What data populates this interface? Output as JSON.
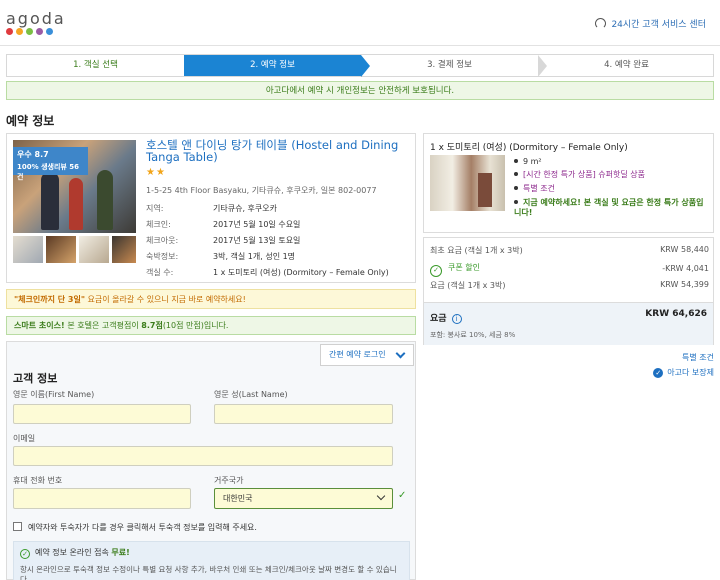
{
  "header": {
    "logo_text": "agoda",
    "logo_colors": [
      "#e03a3e",
      "#f5a623",
      "#7bbf43",
      "#9b5ba5",
      "#3a8fd9"
    ],
    "support_text": "24시간 고객 서비스 센터"
  },
  "steps": [
    {
      "label": "1. 객실 선택",
      "state": "done"
    },
    {
      "label": "2. 예약 정보",
      "state": "active"
    },
    {
      "label": "3. 결제 정보",
      "state": "pending"
    },
    {
      "label": "4. 예약 완료",
      "state": "pending"
    }
  ],
  "secure_notice": "아고다에서 예약 시 개인정보는 안전하게 보호됩니다.",
  "page_title": "예약 정보",
  "hotel": {
    "review_score": "우수 8.7",
    "review_count": "100% 생생리뷰 56건",
    "name": "호스텔 앤 다이닝 탕가 테이블 (Hostel and Dining Tanga Table)",
    "stars": "★★",
    "address": "1-5-25 4th Floor Basyaku, 기타큐슈, 후쿠오카, 일본 802-0077",
    "info": [
      {
        "key": "지역:",
        "value": "기타큐슈, 후쿠오카"
      },
      {
        "key": "체크인:",
        "value": "2017년 5월 10일 수요일"
      },
      {
        "key": "체크아웃:",
        "value": "2017년 5월 13일 토요일"
      },
      {
        "key": "숙박정보:",
        "value": "3박, 객실 1개, 성인 1명"
      },
      {
        "key": "객실 수:",
        "value": "1 x 도미토리 (여성) (Dormitory – Female Only)"
      }
    ]
  },
  "urgency": {
    "highlight": "\"체크인까지 단 3일\"",
    "text": " 요금이 올라갈 수 있으니 지금 바로 예약하세요!"
  },
  "smart_choice": {
    "prefix": "스마트 초이스! ",
    "text": "본 호텔은 고객평점이 ",
    "score": "8.7점",
    "suffix": "(10점 만점)입니다."
  },
  "form": {
    "login_button": "간편 예약 로그인",
    "title": "고객 정보",
    "first_name_label": "영문 이름(First Name)",
    "last_name_label": "영문 성(Last Name)",
    "email_label": "이메일",
    "phone_label": "휴대 전화 번호",
    "country_label": "거주국가",
    "country_value": "대한민국",
    "other_guest_label": "예약자와 투숙자가 다를 경우 클릭해서 투숙객 정보를 입력해 주세요.",
    "online_title": "예약 정보 온라인 접속 ",
    "online_free": "무료!",
    "online_desc": "항시 온라인으로 투숙객 정보 수정이나 특별 요청 사항 추가, 바우처 인쇄 또는 체크인/체크아웃 날짜 변경도 할 수 있습니다."
  },
  "room": {
    "title": "1 x 도미토리 (여성) (Dormitory – Female Only)",
    "features": [
      {
        "text": "9 m²",
        "color": "#555555"
      },
      {
        "text": "[시간 한정 특가 상품] 슈퍼핫딜 상품",
        "color": "#8e2a8e"
      },
      {
        "text": "특별 조건",
        "color": "#8e2a8e"
      },
      {
        "text": "지금 예약하세요! 본 객실 및 요금은 한정 특가 상품입니다!",
        "color": "#3a7c1a"
      }
    ]
  },
  "price": {
    "base_label": "최초 요금 (객실 1개 x 3박)",
    "base_value": "KRW 58,440",
    "coupon_label": "쿠폰 할인",
    "coupon_value": "-KRW 4,041",
    "sub_label": "요금 (객실 1개 x 3박)",
    "sub_value": "KRW 54,399",
    "total_label": "요금",
    "total_value": "KRW 64,626",
    "tax_note": "포함: 봉사료 10%, 세금 8%",
    "special_link": "특별 조건",
    "guarantee_link": "아고다 보장제"
  }
}
